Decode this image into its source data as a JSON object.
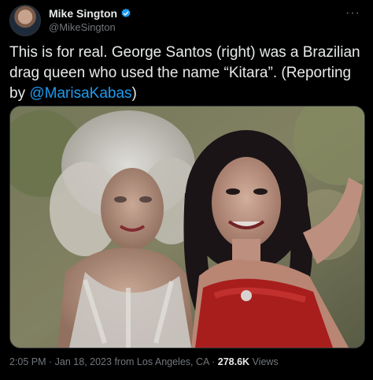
{
  "author": {
    "display_name": "Mike Sington",
    "handle": "@MikeSington",
    "verified_color": "#1d9bf0"
  },
  "menu": {
    "more_label": "···"
  },
  "tweet": {
    "text_before_mention": "This is for real. George Santos (right) was a Brazilian drag queen who used the name “Kitara”. (Reporting by ",
    "mention": "@MarisaKabas",
    "text_after_mention": ")"
  },
  "photo": {
    "icon": "photo-image"
  },
  "meta": {
    "time": "2:05 PM",
    "separator1": " · ",
    "date": "Jan 18, 2023",
    "location": " from Los Angeles, CA",
    "separator2": " · ",
    "views_count": "278.6K",
    "views_label": " Views"
  },
  "colors": {
    "background": "#000000",
    "text": "#e7e9ea",
    "secondary": "#71767b",
    "link": "#1d9bf0"
  }
}
